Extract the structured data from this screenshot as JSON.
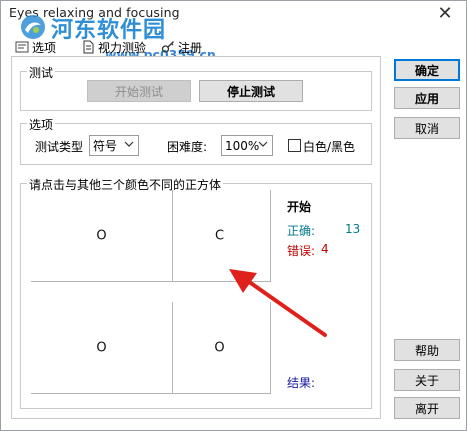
{
  "window": {
    "title": "Eyes relaxing and focusing",
    "close_glyph": "✕"
  },
  "watermark": {
    "name": "河东软件园",
    "url": "www.pc0359.cn"
  },
  "tabs": [
    {
      "label": "选项",
      "icon": "settings-icon"
    },
    {
      "label": "视力测验",
      "icon": "document-icon"
    },
    {
      "label": "注册",
      "icon": "key-icon"
    }
  ],
  "test_group": {
    "label": "测试",
    "start_button": "开始测试",
    "stop_button": "停止测试"
  },
  "options_group": {
    "label": "选项",
    "type_label": "测试类型",
    "type_value": "符号",
    "difficulty_label": "困难度:",
    "difficulty_value": "100%",
    "bw_checkbox_label": "白色/黑色",
    "bw_checked": false
  },
  "squares_group": {
    "label": "请点击与其他三个颜色不同的正方体",
    "squares": [
      "O",
      "C",
      "O",
      "O"
    ]
  },
  "status": {
    "heading": "开始",
    "correct_label": "正确:",
    "correct_value": "13",
    "wrong_label": "错误:",
    "wrong_value": "4",
    "result_label": "结果:"
  },
  "right_buttons": {
    "ok": "确定",
    "apply": "应用",
    "cancel": "取消",
    "help": "帮助",
    "about": "关于",
    "exit": "离开"
  },
  "colors": {
    "correct": "#007a8a",
    "wrong": "#c00000",
    "result": "#1a1aa0",
    "arrow": "#e0201b",
    "watermark": "#2f8fd6"
  }
}
